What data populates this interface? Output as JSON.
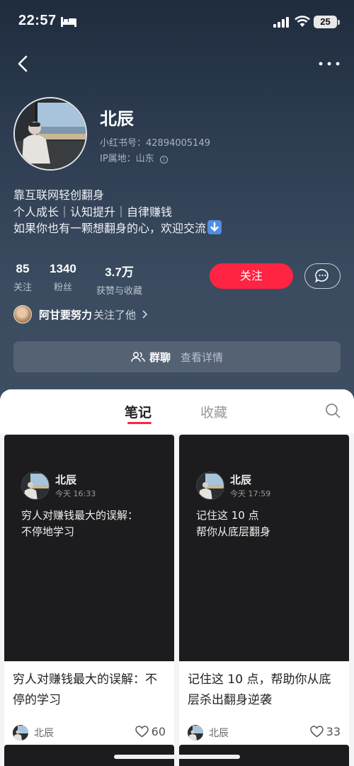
{
  "status_bar": {
    "time": "22:57",
    "battery": "25",
    "icons": [
      "bed-icon",
      "signal-icon",
      "wifi-icon",
      "battery-icon"
    ]
  },
  "profile": {
    "name": "北辰",
    "id_line": "小红书号：42894005149",
    "ip_line": "IP属地：山东",
    "bio": [
      "靠互联网轻创翻身",
      "个人成长｜认知提升｜自律赚钱",
      "如果你也有一颗想翻身的心，欢迎交流"
    ],
    "stats": [
      {
        "num": "85",
        "label": "关注"
      },
      {
        "num": "1340",
        "label": "粉丝"
      },
      {
        "num": "3.7万",
        "label": "获赞与收藏"
      }
    ],
    "follow_label": "关注",
    "followed_by": {
      "name": "阿甘要努力",
      "text": "关注了他"
    },
    "group": {
      "label": "群聊",
      "detail": "查看详情"
    }
  },
  "tabs": [
    {
      "label": "笔记",
      "active": true
    },
    {
      "label": "收藏",
      "active": false
    }
  ],
  "notes": [
    {
      "cover_author": "北辰",
      "cover_time": "今天 16:33",
      "cover_lines": [
        "穷人对赚钱最大的误解：",
        "不停地学习"
      ],
      "title": "穷人对赚钱最大的误解：不停的学习",
      "author": "北辰",
      "likes": "60"
    },
    {
      "cover_author": "北辰",
      "cover_time": "今天 17:59",
      "cover_lines": [
        "记住这 10 点",
        "帮你从底层翻身"
      ],
      "title": "记住这 10 点，帮助你从底层杀出翻身逆袭",
      "author": "北辰",
      "likes": "33"
    }
  ],
  "colors": {
    "accent": "#ff2442",
    "header": "#2e3d52",
    "card_cover": "#1c1c1e"
  }
}
